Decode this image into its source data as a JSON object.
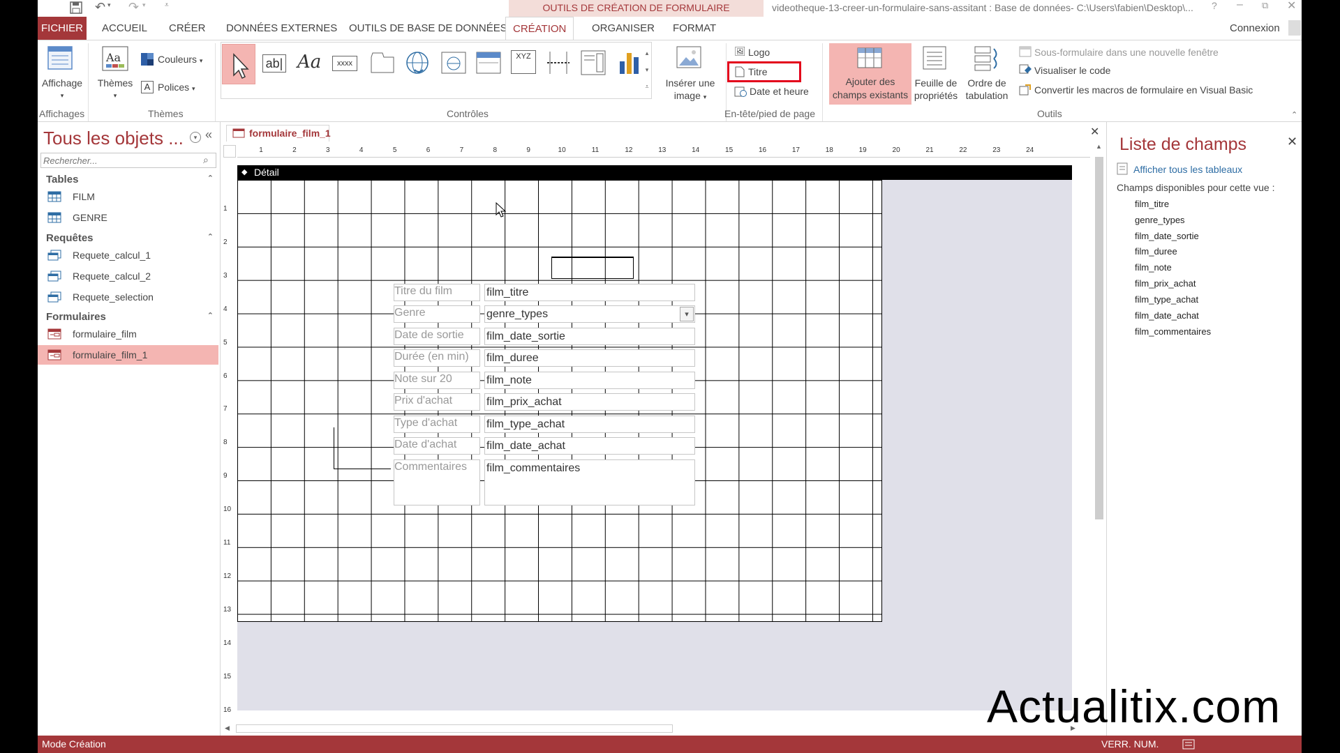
{
  "titlebar": {
    "context_group": "OUTILS DE CRÉATION DE FORMULAIRE",
    "document_title": "videotheque-13-creer-un-formulaire-sans-assitant : Base de données- C:\\Users\\fabien\\Desktop\\..."
  },
  "tabs": {
    "file": "FICHIER",
    "home": "ACCUEIL",
    "create": "CRÉER",
    "external": "DONNÉES EXTERNES",
    "dbtools": "OUTILS DE BASE DE DONNÉES",
    "design": "CRÉATION",
    "arrange": "ORGANISER",
    "format": "FORMAT",
    "signin": "Connexion"
  },
  "ribbon": {
    "views": {
      "view_label": "Affichage",
      "group_label": "Affichages"
    },
    "themes": {
      "themes_label": "Thèmes",
      "colors_label": "Couleurs",
      "fonts_label": "Polices",
      "group_label": "Thèmes"
    },
    "controls": {
      "group_label": "Contrôles",
      "text_ctrl": "ab|",
      "label_ctrl": "Aa",
      "button_ctrl": "xxxx",
      "option_ctrl": "XYZ"
    },
    "insert_image": {
      "line1": "Insérer une",
      "line2": "image"
    },
    "header_footer": {
      "logo": "Logo",
      "title": "Titre",
      "datetime": "Date et heure",
      "group_label": "En-tête/pied de page"
    },
    "tools": {
      "add_fields_1": "Ajouter des",
      "add_fields_2": "champs existants",
      "property_sheet_1": "Feuille de",
      "property_sheet_2": "propriétés",
      "tab_order_1": "Ordre de",
      "tab_order_2": "tabulation",
      "subform_new_window": "Sous-formulaire dans une nouvelle fenêtre",
      "view_code": "Visualiser le code",
      "convert_macros": "Convertir les macros de formulaire en Visual Basic",
      "group_label": "Outils"
    }
  },
  "nav": {
    "title": "Tous les objets ...",
    "search_placeholder": "Rechercher...",
    "categories": [
      {
        "label": "Tables",
        "items": [
          "FILM",
          "GENRE"
        ]
      },
      {
        "label": "Requêtes",
        "items": [
          "Requete_calcul_1",
          "Requete_calcul_2",
          "Requete_selection"
        ]
      },
      {
        "label": "Formulaires",
        "items": [
          "formulaire_film",
          "formulaire_film_1"
        ]
      }
    ]
  },
  "document": {
    "tab_label": "formulaire_film_1",
    "section_label": "Détail",
    "ruler_h": [
      "1",
      "2",
      "3",
      "4",
      "5",
      "6",
      "7",
      "8",
      "9",
      "10",
      "11",
      "12",
      "13",
      "14",
      "15",
      "16",
      "17",
      "18",
      "19",
      "20",
      "21",
      "22",
      "23",
      "24"
    ],
    "ruler_v": [
      "1",
      "2",
      "3",
      "4",
      "5",
      "6",
      "7",
      "8",
      "9",
      "10",
      "11",
      "12",
      "13",
      "14",
      "15",
      "16"
    ],
    "form_rows": [
      {
        "label": "Titre du film",
        "field": "film_titre"
      },
      {
        "label": "Genre",
        "field": "genre_types"
      },
      {
        "label": "Date de sortie",
        "field": "film_date_sortie"
      },
      {
        "label": "Durée (en min)",
        "field": "film_duree"
      },
      {
        "label": "Note sur 20",
        "field": "film_note"
      },
      {
        "label": "Prix d'achat",
        "field": "film_prix_achat"
      },
      {
        "label": "Type d'achat",
        "field": "film_type_achat"
      },
      {
        "label": "Date d'achat",
        "field": "film_date_achat"
      },
      {
        "label": "Commentaires",
        "field": "film_commentaires"
      }
    ]
  },
  "fieldlist": {
    "title": "Liste de champs",
    "show_all": "Afficher tous les tableaux",
    "available": "Champs disponibles pour cette vue :",
    "fields": [
      "film_titre",
      "genre_types",
      "film_date_sortie",
      "film_duree",
      "film_note",
      "film_prix_achat",
      "film_type_achat",
      "film_date_achat",
      "film_commentaires"
    ]
  },
  "status": {
    "mode": "Mode Création",
    "numlock": "VERR. NUM."
  },
  "watermark": "Actualitix.com",
  "colors": {
    "accent": "#a4373a",
    "selected_nav": "#f4b5b2",
    "highlight_box": "#e3001b"
  }
}
